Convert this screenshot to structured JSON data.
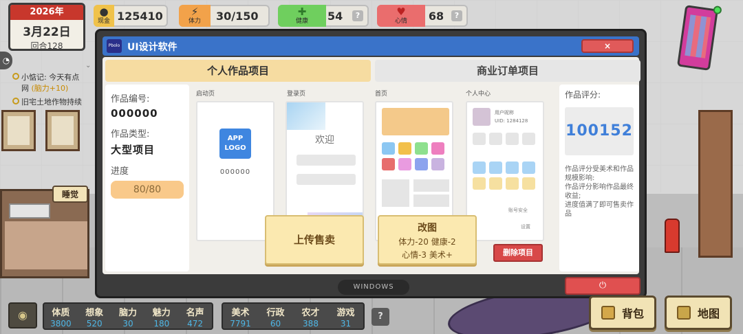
{
  "hud": {
    "year": "2026年",
    "date": "3月22日",
    "round": "回合128",
    "cash_label": "现金",
    "cash": "125410",
    "energy_label": "体力",
    "energy": "30/150",
    "health_label": "健康",
    "health": "54",
    "mood_label": "心情",
    "mood": "68",
    "help": "?"
  },
  "log": {
    "line1_prefix": "小惦记: 今天有点",
    "line1_suffix": "网",
    "line1_highlight": "(脑力+10)",
    "line2": "旧宅土地作物持续"
  },
  "scene": {
    "sleep_label": "睡觉"
  },
  "window": {
    "app_icon": "Pbolo",
    "title": "UI设计软件",
    "close": "×",
    "tabs": [
      "个人作品项目",
      "商业订单项目"
    ],
    "info": {
      "id_label": "作品编号:",
      "id_value": "000000",
      "type_label": "作品类型:",
      "type_value": "大型项目",
      "progress_label": "进度",
      "progress_text": "80/80",
      "progress_fraction": 1.0
    },
    "screens": {
      "splash": "启动页",
      "login": "登录页",
      "home": "首页",
      "profile": "个人中心"
    },
    "mock": {
      "logo_line1": "APP",
      "logo_line2": "LOGO",
      "splash_code": "000000",
      "welcome": "欢迎",
      "nickname": "用户昵称",
      "uid": "UID: 1284128",
      "account_security": "账号安全",
      "settings": "设置"
    },
    "score": {
      "label": "作品评分:",
      "value": "100152",
      "desc1": "作品评分受美术和作品规模影响:",
      "desc2": "作品评分影响作品最终收益;",
      "desc3": "进度值满了即可售卖作品"
    },
    "buttons": {
      "upload": "上传售卖",
      "revise_title": "改图",
      "revise_cost1": "体力-20 健康-2",
      "revise_cost2": "心情-3 美术+",
      "delete": "删除项目",
      "power": "⏻"
    },
    "taskbar": "WINDOWS"
  },
  "attrs_left": [
    {
      "name": "体质",
      "value": "3800"
    },
    {
      "name": "想象",
      "value": "520"
    },
    {
      "name": "脑力",
      "value": "30"
    },
    {
      "name": "魅力",
      "value": "180"
    },
    {
      "name": "名声",
      "value": "472"
    }
  ],
  "attrs_right": [
    {
      "name": "美术",
      "value": "7791"
    },
    {
      "name": "行政",
      "value": "60"
    },
    {
      "name": "农才",
      "value": "388"
    },
    {
      "name": "游戏",
      "value": "31"
    }
  ],
  "bottom": {
    "help": "?",
    "bag": "背包",
    "map": "地图"
  },
  "colors": {
    "accent_blue": "#3a73c9",
    "danger_red": "#d84848",
    "tab_active": "#f6dca1",
    "score_blue": "#3f7fd9"
  }
}
